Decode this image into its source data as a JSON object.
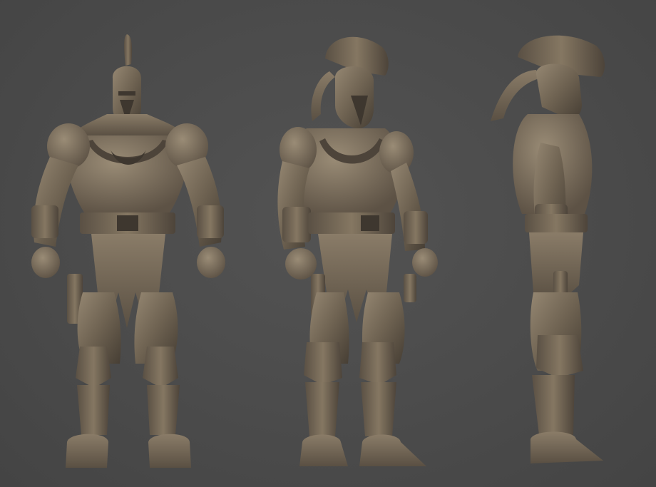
{
  "scene": {
    "background_color": "#4a4a4a",
    "sculpt_color": "#6b6052",
    "sculpt_highlight": "#948672",
    "sculpt_shadow": "#3e372f",
    "views": [
      {
        "name": "front-view"
      },
      {
        "name": "three-quarter-view"
      },
      {
        "name": "side-view"
      }
    ]
  }
}
